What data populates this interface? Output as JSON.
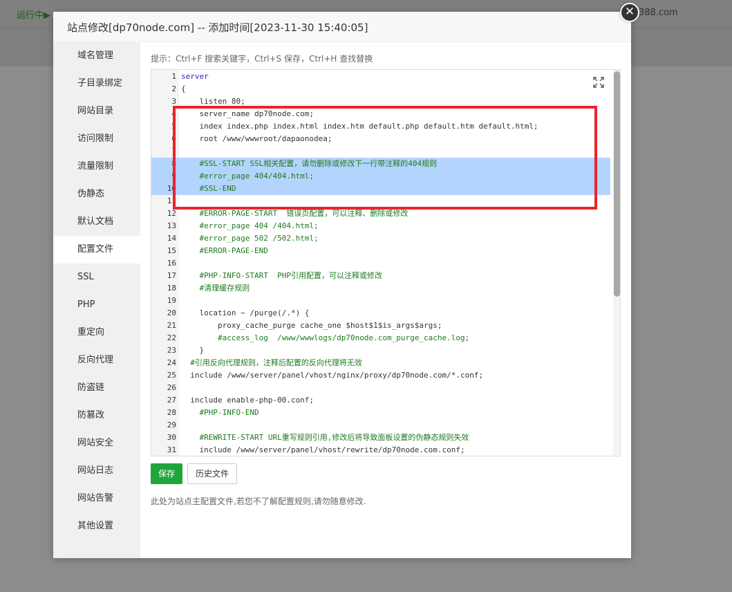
{
  "background": {
    "status": "运行中▶",
    "domain": "388.com"
  },
  "modal": {
    "title": "站点修改[dp70node.com] -- 添加时间[2023-11-30 15:40:05]",
    "close_symbol": "✕"
  },
  "sidebar": {
    "items": [
      {
        "label": "域名管理"
      },
      {
        "label": "子目录绑定"
      },
      {
        "label": "网站目录"
      },
      {
        "label": "访问限制"
      },
      {
        "label": "流量限制"
      },
      {
        "label": "伪静态"
      },
      {
        "label": "默认文档"
      },
      {
        "label": "配置文件",
        "active": true
      },
      {
        "label": "SSL"
      },
      {
        "label": "PHP"
      },
      {
        "label": "重定向"
      },
      {
        "label": "反向代理"
      },
      {
        "label": "防盗链"
      },
      {
        "label": "防篡改"
      },
      {
        "label": "网站安全"
      },
      {
        "label": "网站日志"
      },
      {
        "label": "网站告警"
      },
      {
        "label": "其他设置"
      }
    ]
  },
  "content": {
    "hint": "提示：Ctrl+F 搜索关键字，Ctrl+S 保存，Ctrl+H 查找替换",
    "note": "此处为站点主配置文件,若您不了解配置规则,请勿随意修改.",
    "save_label": "保存",
    "history_label": "历史文件"
  },
  "editor": {
    "lines": [
      {
        "n": "1",
        "text": "server",
        "type": "kw"
      },
      {
        "n": "2",
        "text": "{",
        "type": "default"
      },
      {
        "n": "3",
        "text": "    listen 80;",
        "type": "default"
      },
      {
        "n": "4",
        "text": "    server_name dp70node.com;",
        "type": "default"
      },
      {
        "n": "5",
        "text": "    index index.php index.html index.htm default.php default.htm default.html;",
        "type": "default"
      },
      {
        "n": "6",
        "text": "    root /www/wwwroot/dapaonodea;",
        "type": "default"
      },
      {
        "n": "7",
        "text": "",
        "type": "default"
      },
      {
        "n": "8",
        "text": "    #SSL-START SSL相关配置，请勿删除或修改下一行带注释的404规则",
        "type": "cm",
        "selected": true
      },
      {
        "n": "9",
        "text": "    #error_page 404/404.html;",
        "type": "cm",
        "selected": true
      },
      {
        "n": "10",
        "text": "    #SSL-END",
        "type": "cm",
        "selected": true
      },
      {
        "n": "11",
        "text": "",
        "type": "default"
      },
      {
        "n": "12",
        "text": "    #ERROR-PAGE-START  错误页配置，可以注释、删除或修改",
        "type": "cm"
      },
      {
        "n": "13",
        "text": "    #error_page 404 /404.html;",
        "type": "cm"
      },
      {
        "n": "14",
        "text": "    #error_page 502 /502.html;",
        "type": "cm"
      },
      {
        "n": "15",
        "text": "    #ERROR-PAGE-END",
        "type": "cm"
      },
      {
        "n": "16",
        "text": "",
        "type": "default"
      },
      {
        "n": "17",
        "text": "    #PHP-INFO-START  PHP引用配置，可以注释或修改",
        "type": "cm"
      },
      {
        "n": "18",
        "text": "    #清理缓存规则",
        "type": "cm"
      },
      {
        "n": "19",
        "text": "",
        "type": "default"
      },
      {
        "n": "20",
        "text": "    location ~ /purge(/.*) {",
        "type": "default"
      },
      {
        "n": "21",
        "text": "        proxy_cache_purge cache_one $host$1$is_args$args;",
        "type": "default"
      },
      {
        "n": "22",
        "text": "        #access_log  /www/wwwlogs/dp70node.com_purge_cache.log;",
        "type": "cm"
      },
      {
        "n": "23",
        "text": "    }",
        "type": "default"
      },
      {
        "n": "24",
        "text": "  #引用反向代理规则，注释后配置的反向代理将无效",
        "type": "cm"
      },
      {
        "n": "25",
        "text": "  include /www/server/panel/vhost/nginx/proxy/dp70node.com/*.conf;",
        "type": "default"
      },
      {
        "n": "26",
        "text": "",
        "type": "default"
      },
      {
        "n": "27",
        "text": "  include enable-php-00.conf;",
        "type": "default"
      },
      {
        "n": "28",
        "text": "    #PHP-INFO-END",
        "type": "cm"
      },
      {
        "n": "29",
        "text": "",
        "type": "default"
      },
      {
        "n": "30",
        "text": "    #REWRITE-START URL重写规则引用,修改后将导致面板设置的伪静态规则失效",
        "type": "cm"
      },
      {
        "n": "31",
        "text": "    include /www/server/panel/vhost/rewrite/dp70node.com.conf;",
        "type": "default"
      }
    ]
  },
  "colors": {
    "accent": "#20a53a",
    "selection": "#b3d4fc",
    "highlight_box": "#e8252b",
    "keyword": "#2b2bb8",
    "comment": "#1f7a1f"
  }
}
